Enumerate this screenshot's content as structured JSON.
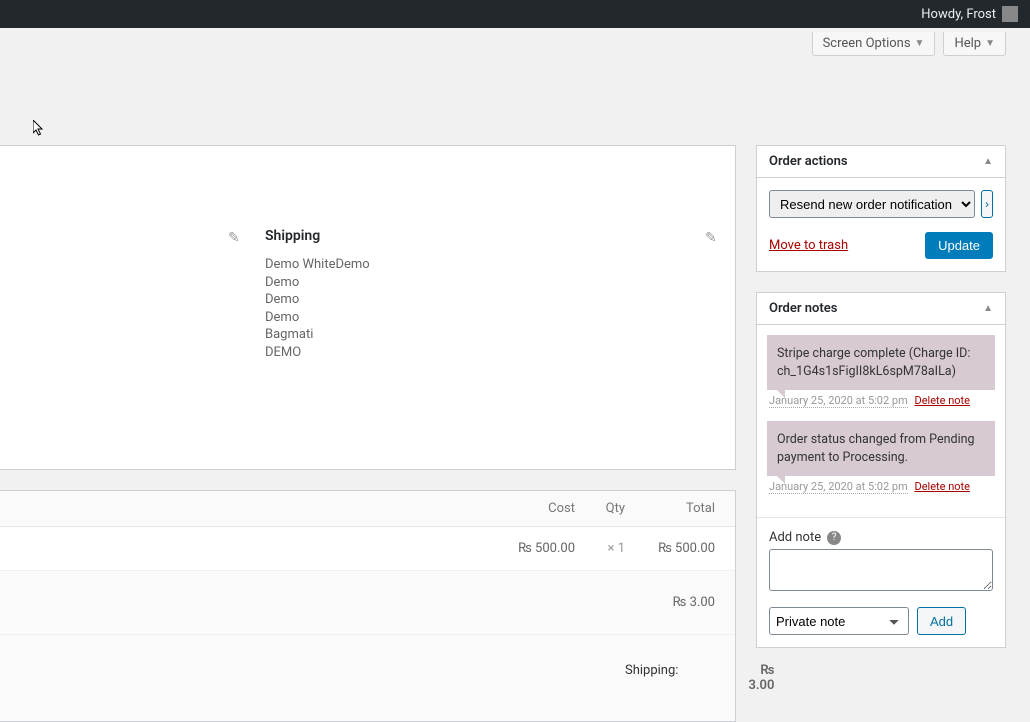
{
  "admin_bar": {
    "greeting": "Howdy, Frost"
  },
  "top_tabs": {
    "screen_options": "Screen Options",
    "help": "Help"
  },
  "shipping": {
    "title": "Shipping",
    "lines": [
      "Demo WhiteDemo",
      "Demo",
      "Demo",
      "Demo",
      "Bagmati",
      "DEMO"
    ]
  },
  "items_table": {
    "headers": {
      "cost": "Cost",
      "qty": "Qty",
      "total": "Total"
    },
    "row": {
      "cost": "₨ 500.00",
      "qty": "× 1",
      "total": "₨ 500.00"
    },
    "shipping_total": "₨ 3.00",
    "footer": {
      "label": "Shipping:",
      "value": "₨ 3.00"
    }
  },
  "order_actions": {
    "title": "Order actions",
    "selected_action": "Resend new order notification",
    "trash": "Move to trash",
    "update": "Update"
  },
  "order_notes": {
    "title": "Order notes",
    "notes": [
      {
        "text": "Stripe charge complete (Charge ID: ch_1G4s1sFigII8kL6spM78aILa)",
        "ts": "January 25, 2020 at 5:02 pm",
        "del": "Delete note"
      },
      {
        "text": "Order status changed from Pending payment to Processing.",
        "ts": "January 25, 2020 at 5:02 pm",
        "del": "Delete note"
      }
    ],
    "add_label": "Add note",
    "note_type": "Private note",
    "add_btn": "Add"
  }
}
